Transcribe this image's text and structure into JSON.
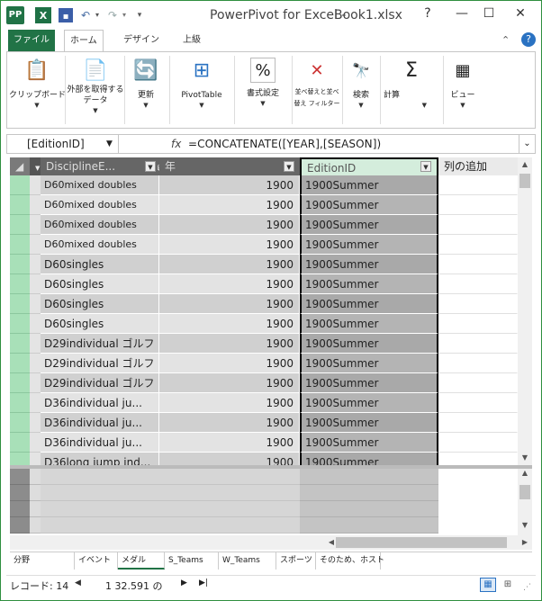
{
  "titlebar": {
    "app_icon": "PP",
    "excel_icon": "X",
    "app_name": "PowerPivot for Excel -",
    "file_name": "Book1.xlsx",
    "buttons": {
      "help": "?",
      "minimize": "—",
      "maximize": "☐",
      "close": "✕"
    }
  },
  "ribbon_tabs": [
    {
      "label": "ファイル"
    },
    {
      "label": "ホーム"
    },
    {
      "label": "デザイン"
    },
    {
      "label": "上級"
    }
  ],
  "ribbon_groups": [
    {
      "label": "クリップボード",
      "icon": "clipboard-icon",
      "glyph": "📋"
    },
    {
      "label": "外部を取得する データ",
      "icon": "get-data-icon",
      "glyph": "📄"
    },
    {
      "label": "更新",
      "icon": "refresh-icon",
      "glyph": "🔄"
    },
    {
      "label": "PivotTable",
      "icon": "pivottable-icon",
      "glyph": "⊞"
    },
    {
      "label": "書式設定",
      "icon": "percent-icon",
      "glyph": "%"
    },
    {
      "label": "並べ替えと並べ替え フィルター",
      "icon": "filter-clear-icon",
      "glyph": "✕"
    },
    {
      "label": "検索",
      "icon": "binoculars-icon",
      "glyph": "🔭"
    },
    {
      "label": "計算",
      "icon": "sigma-icon",
      "glyph": "Σ"
    },
    {
      "label": "ビュー",
      "icon": "view-icon",
      "glyph": "▦"
    }
  ],
  "formula_bar": {
    "name_box": "[EditionID]",
    "fx": "fx",
    "formula": "=CONCATENATE([YEAR],[SEASON])"
  },
  "table": {
    "columns": [
      "DisciplineE...",
      "年",
      "EditionID",
      "列の追加"
    ],
    "rows": [
      {
        "discipline": "D60mixed doubles",
        "year": "1900",
        "edition": "1900Summer"
      },
      {
        "discipline": "D60mixed doubles",
        "year": "1900",
        "edition": "1900Summer"
      },
      {
        "discipline": "D60mixed doubles",
        "year": "1900",
        "edition": "1900Summer"
      },
      {
        "discipline": "D60mixed doubles",
        "year": "1900",
        "edition": "1900Summer"
      },
      {
        "discipline": "D60singles",
        "year": "1900",
        "edition": "1900Summer"
      },
      {
        "discipline": "D60singles",
        "year": "1900",
        "edition": "1900Summer"
      },
      {
        "discipline": "D60singles",
        "year": "1900",
        "edition": "1900Summer"
      },
      {
        "discipline": "D60singles",
        "year": "1900",
        "edition": "1900Summer"
      },
      {
        "discipline": "D29individual ゴルフ",
        "year": "1900",
        "edition": "1900Summer"
      },
      {
        "discipline": "D29individual ゴルフ",
        "year": "1900",
        "edition": "1900Summer"
      },
      {
        "discipline": "D29individual ゴルフ",
        "year": "1900",
        "edition": "1900Summer"
      },
      {
        "discipline": "D36individual ju...",
        "year": "1900",
        "edition": "1900Summer"
      },
      {
        "discipline": "D36individual ju...",
        "year": "1900",
        "edition": "1900Summer"
      },
      {
        "discipline": "D36individual ju...",
        "year": "1900",
        "edition": "1900Summer"
      },
      {
        "discipline": "D36long jump ind...",
        "year": "1900",
        "edition": "1900Summer"
      }
    ]
  },
  "sheet_tabs": [
    "分野",
    "イベント",
    "メダル",
    "S_Teams",
    "W_Teams",
    "スポーツ",
    "そのため、ホスト"
  ],
  "active_sheet": "メダル",
  "status": {
    "record_label": "レコード: 14",
    "record_count": "1 32.591 の"
  },
  "colors": {
    "accent": "#217346",
    "row_selector": "#a8e0b8",
    "header": "#666666",
    "selected_header": "#d4eddc"
  }
}
